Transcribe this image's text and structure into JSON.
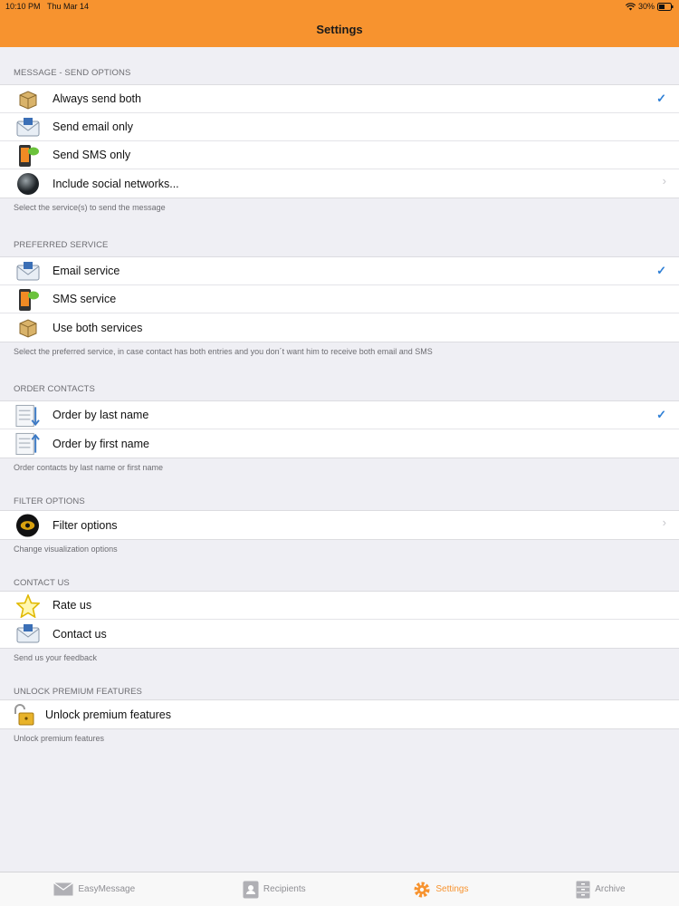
{
  "status": {
    "time": "10:10 PM",
    "date": "Thu Mar 14",
    "battery": "30%"
  },
  "nav": {
    "title": "Settings"
  },
  "sections": {
    "send": {
      "header": "MESSAGE - SEND OPTIONS",
      "items": [
        "Always send both",
        "Send email only",
        "Send SMS only",
        "Include social networks..."
      ],
      "footer": "Select the service(s) to send the message"
    },
    "preferred": {
      "header": "PREFERRED SERVICE",
      "items": [
        "Email service",
        "SMS service",
        "Use both services"
      ],
      "footer": "Select the preferred service, in case contact has both entries and you don´t want him to receive both email and SMS"
    },
    "order": {
      "header": "ORDER CONTACTS",
      "items": [
        "Order by last name",
        "Order by first name"
      ],
      "footer": "Order contacts by last name or first name"
    },
    "filter": {
      "header": "FILTER OPTIONS",
      "items": [
        "Filter options"
      ],
      "footer": "Change visualization options"
    },
    "contact": {
      "header": "CONTACT US",
      "items": [
        "Rate us",
        "Contact us"
      ],
      "footer": "Send us your feedback"
    },
    "premium": {
      "header": "UNLOCK PREMIUM FEATURES",
      "items": [
        "Unlock premium features"
      ],
      "footer": "Unlock premium features"
    }
  },
  "tabs": [
    "EasyMessage",
    "Recipients",
    "Settings",
    "Archive"
  ],
  "colors": {
    "accent": "#f7932f",
    "check": "#2e7fd6"
  }
}
